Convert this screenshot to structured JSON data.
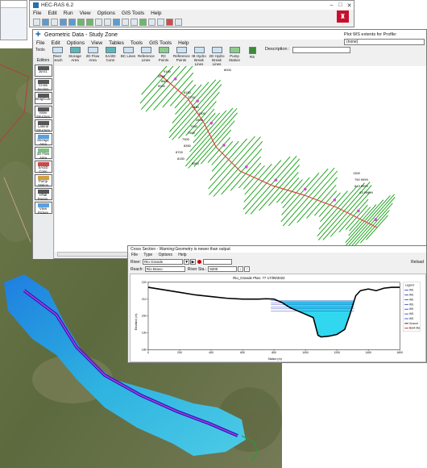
{
  "main_window": {
    "title": "HEC-RAS 6.2",
    "menu": [
      "File",
      "Edit",
      "Run",
      "View",
      "Options",
      "GIS Tools",
      "Help"
    ],
    "controls": [
      "–",
      "□",
      "✕"
    ],
    "logo": "usace-castle-icon"
  },
  "geometric_window": {
    "title": "Geometric Data - Study Zone",
    "menu": [
      "File",
      "Edit",
      "Options",
      "View",
      "Tables",
      "Tools",
      "GIS Tools",
      "Help"
    ],
    "tools_tab": "Tools",
    "toolbar_buttons": [
      "River Reach",
      "Storage Area",
      "2D Flow Area",
      "SA/2D Conn",
      "BC Lines",
      "Reference Lines",
      "RC Points",
      "Reference Points",
      "IB Hydro Break Lines",
      "2D Hydro Break Lines",
      "Pump Station",
      "RS"
    ],
    "description_label": "Description :",
    "plot_ws_label": "Plot WS extents for Profile:",
    "plot_ws_value": "(none)",
    "editors_title": "Editors",
    "editors": [
      "Junct.",
      "Cross Section",
      "Brdg/Culv",
      "Inline Structure",
      "Lateral Structure",
      "Storage Area",
      "2D Flow Area",
      "SA/2D Conn",
      "Pump Station",
      "HTab Param.",
      "View Picture"
    ],
    "station_labels": [
      "9150",
      "9250",
      "8600",
      "9000",
      "8150",
      "7700",
      "1450",
      "1300",
      "2800",
      "7050",
      "7500",
      "7900",
      "8350",
      "8700",
      "8150",
      "9900",
      "1300",
      "790 9999",
      "549 9999",
      "43 99999",
      "8000"
    ]
  },
  "xs_window": {
    "title": "Cross Section - Warning:Geometry is newer than output",
    "menu": [
      "File",
      "Type",
      "Options",
      "Help"
    ],
    "river_label": "River:",
    "river_value": "Rio Grande",
    "reach_label": "Reach:",
    "reach_value": "Rio Bravo",
    "river_sta_label": "River Sta.:",
    "river_sta_value": "9200",
    "reload_label": "Reload",
    "plot_title": "Rio_Grande    Plan: 77    17/09/2022",
    "legend": [
      "Legend",
      "WS",
      "WS",
      "WS",
      "WS",
      "WS",
      "WS",
      "WS",
      "Ground",
      "Bank Sta"
    ]
  },
  "chart_data": {
    "type": "line",
    "title": "Rio_Grande    Plan: 77    17/09/2022",
    "xlabel": "Station (m)",
    "ylabel": "Elevation (m)",
    "xlim": [
      0,
      1600
    ],
    "ylim": [
      180,
      220
    ],
    "xticks": [
      0,
      200,
      400,
      600,
      800,
      1000,
      1200,
      1400,
      1600
    ],
    "yticks": [
      180,
      190,
      200,
      210,
      220
    ],
    "series": [
      {
        "name": "Ground",
        "x": [
          0,
          100,
          200,
          300,
          400,
          500,
          600,
          700,
          750,
          800,
          850,
          900,
          950,
          1000,
          1050,
          1080,
          1100,
          1150,
          1200,
          1250,
          1280,
          1320,
          1350,
          1400,
          1450,
          1500,
          1550,
          1600
        ],
        "y": [
          217,
          215.5,
          214,
          212.5,
          211.5,
          210.5,
          210,
          210,
          210.2,
          210,
          208,
          205,
          203,
          201,
          199,
          188.5,
          187.5,
          188,
          189,
          192,
          200,
          212,
          215,
          216,
          215,
          216.5,
          217,
          217
        ]
      },
      {
        "name": "WS",
        "x": [
          780,
          1310
        ],
        "y": [
          209,
          209
        ]
      }
    ]
  },
  "colors": {
    "water": "#31d7ee",
    "ground_line": "#000000",
    "ws_line": "#1c33b8",
    "xs_lines": "#0ea00e",
    "river_line": "#e04646",
    "magenta": "#d848d8"
  }
}
